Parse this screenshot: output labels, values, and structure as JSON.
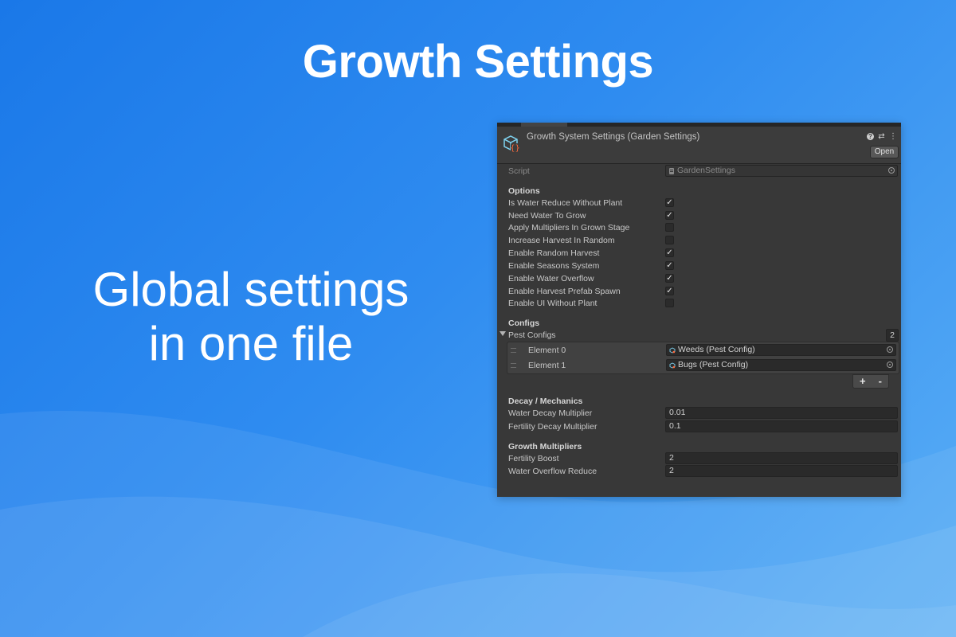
{
  "headline": "Growth Settings",
  "tagline": [
    "Global settings",
    "in one file"
  ],
  "inspector": {
    "title": "Growth System Settings (Garden Settings)",
    "open_label": "Open",
    "script_label": "Script",
    "script_value": "GardenSettings",
    "options_header": "Options",
    "options": [
      {
        "label": "Is Water Reduce Without Plant",
        "checked": true
      },
      {
        "label": "Need Water To Grow",
        "checked": true
      },
      {
        "label": "Apply Multipliers In Grown Stage",
        "checked": false
      },
      {
        "label": "Increase Harvest In Random",
        "checked": false
      },
      {
        "label": "Enable Random Harvest",
        "checked": true
      },
      {
        "label": "Enable Seasons System",
        "checked": true
      },
      {
        "label": "Enable Water Overflow",
        "checked": true
      },
      {
        "label": "Enable Harvest Prefab Spawn",
        "checked": true
      },
      {
        "label": "Enable UI Without Plant",
        "checked": false
      }
    ],
    "configs_header": "Configs",
    "pest_configs_label": "Pest Configs",
    "pest_configs_count": "2",
    "pest_elements": [
      {
        "label": "Element 0",
        "value": "Weeds (Pest Config)"
      },
      {
        "label": "Element 1",
        "value": "Bugs (Pest Config)"
      }
    ],
    "add_label": "+",
    "remove_label": "-",
    "decay_header": "Decay / Mechanics",
    "decay_fields": [
      {
        "label": "Water Decay Multiplier",
        "value": "0.01"
      },
      {
        "label": "Fertility Decay Multiplier",
        "value": "0.1"
      }
    ],
    "growth_header": "Growth Multipliers",
    "growth_fields": [
      {
        "label": "Fertility Boost",
        "value": "2"
      },
      {
        "label": "Water Overflow Reduce",
        "value": "2"
      }
    ],
    "header_icons": [
      "help-icon",
      "presets-icon",
      "kebab-menu-icon"
    ]
  }
}
